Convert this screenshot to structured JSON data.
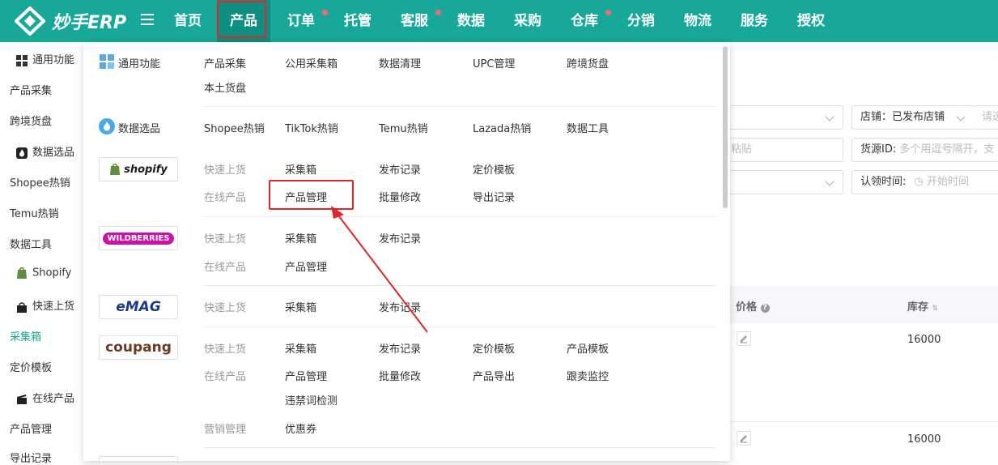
{
  "app": {
    "logo_text": "妙手ERP"
  },
  "nav": {
    "items": [
      {
        "label": "首页",
        "dot": false
      },
      {
        "label": "产品",
        "dot": false
      },
      {
        "label": "订单",
        "dot": true
      },
      {
        "label": "托管",
        "dot": false
      },
      {
        "label": "客服",
        "dot": true
      },
      {
        "label": "数据",
        "dot": false
      },
      {
        "label": "采购",
        "dot": false
      },
      {
        "label": "仓库",
        "dot": true
      },
      {
        "label": "分销",
        "dot": false
      },
      {
        "label": "物流",
        "dot": false
      },
      {
        "label": "服务",
        "dot": false
      },
      {
        "label": "授权",
        "dot": false
      }
    ],
    "active_label": "产品"
  },
  "sidebar": {
    "items": [
      {
        "label": "通用功能",
        "icon": "grid-icon"
      },
      {
        "label": "产品采集"
      },
      {
        "label": "跨境货盘"
      },
      {
        "label": "数据选品",
        "icon": "fire-icon"
      },
      {
        "label": "Shopee热销"
      },
      {
        "label": "Temu热销"
      },
      {
        "label": "数据工具"
      },
      {
        "label": "Shopify",
        "icon": "shopify-bag-icon"
      },
      {
        "label": "快速上货",
        "icon": "lock-bag-icon"
      },
      {
        "label": "采集箱",
        "active": true
      },
      {
        "label": "定价模板"
      },
      {
        "label": "在线产品",
        "icon": "clapper-icon"
      },
      {
        "label": "产品管理"
      },
      {
        "label": "导出记录"
      }
    ]
  },
  "background": {
    "shop_filter_label": "店铺：",
    "shop_filter_value": "已发布店铺",
    "shop_filter_extra": "请选",
    "paste_placeholder": "粘贴",
    "source_id_label": "货源ID:",
    "source_id_placeholder": "多个用逗号隔开，支",
    "claim_time_label": "认领时间:",
    "claim_time_placeholder": "开始时间",
    "table": {
      "columns": [
        "价格",
        "库存"
      ],
      "rows": [
        {
          "stock": "16000"
        },
        {
          "stock": "16000"
        }
      ]
    }
  },
  "menu": {
    "general": {
      "label": "通用功能",
      "links": [
        "产品采集",
        "公用采集箱",
        "数据清理",
        "UPC管理",
        "跨境货盘",
        "本土货盘"
      ]
    },
    "data_selection": {
      "label": "数据选品",
      "links": [
        "Shopee热销",
        "TikTok热销",
        "Temu热销",
        "Lazada热销",
        "数据工具"
      ]
    },
    "shopify": {
      "brand": "shopify",
      "row1_label": "快速上货",
      "row1_links": [
        "采集箱",
        "发布记录",
        "定价模板"
      ],
      "row2_label": "在线产品",
      "row2_links": [
        "产品管理",
        "批量修改",
        "导出记录"
      ]
    },
    "wildberries": {
      "brand": "WILDBERRIES",
      "row1_label": "快速上货",
      "row1_links": [
        "采集箱",
        "发布记录"
      ],
      "row2_label": "在线产品",
      "row2_links": [
        "产品管理"
      ]
    },
    "emag": {
      "brand": "eMAG",
      "row1_label": "快速上货",
      "row1_links": [
        "采集箱",
        "发布记录"
      ]
    },
    "coupang": {
      "brand": "coupang",
      "row1_label": "快速上货",
      "row1_links": [
        "采集箱",
        "发布记录",
        "定价模板",
        "产品模板"
      ],
      "row2_label": "在线产品",
      "row2_links": [
        "产品管理",
        "批量修改",
        "产品导出",
        "跟卖监控"
      ],
      "row3_links": [
        "违禁词检测"
      ],
      "row4_label": "营销管理",
      "row4_links": [
        "优惠券"
      ]
    }
  },
  "colors": {
    "brand_teal": "#17a89a",
    "highlight_red": "#e0262a",
    "dot_red": "#f56c6c"
  }
}
